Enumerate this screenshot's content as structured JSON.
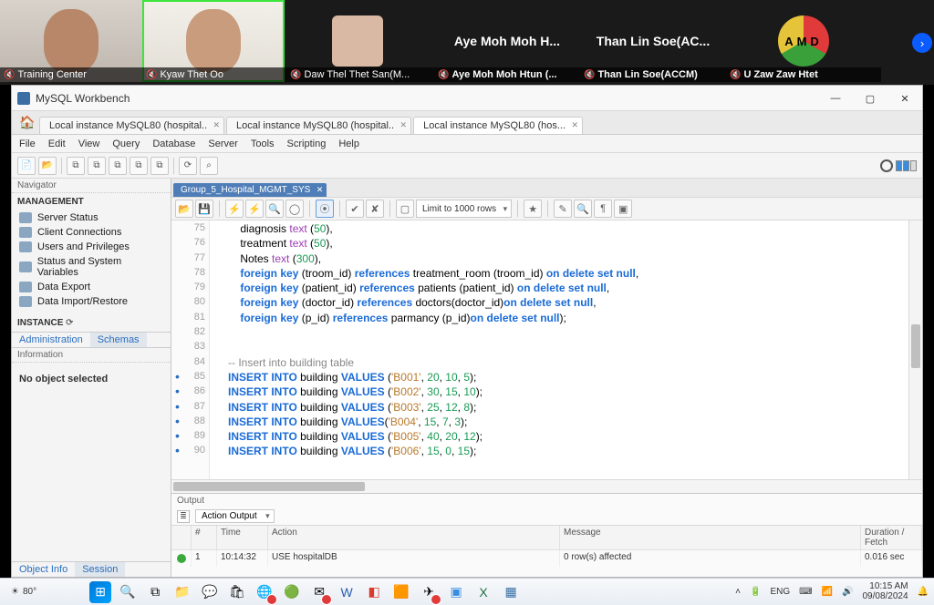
{
  "zoom": {
    "participants": [
      {
        "name": "Training Center",
        "muted": true,
        "type": "video"
      },
      {
        "name": "Kyaw Thet Oo",
        "muted": true,
        "type": "video",
        "highlighted": true
      },
      {
        "name": "Daw Thel Thet San(M...",
        "muted": true,
        "type": "video"
      },
      {
        "name": "Aye Moh Moh Htun (...",
        "muted": true,
        "display": "Aye Moh Moh H..."
      },
      {
        "name": "Than Lin Soe(ACCM)",
        "muted": true,
        "display": "Than Lin Soe(AC..."
      },
      {
        "name": "U Zaw Zaw Htet",
        "muted": true,
        "type": "logo"
      }
    ]
  },
  "workbench": {
    "title": "MySQL Workbench",
    "tabs": [
      {
        "label": "Local instance MySQL80 (hospital..",
        "active": false
      },
      {
        "label": "Local instance MySQL80 (hospital..",
        "active": false
      },
      {
        "label": "Local instance MySQL80 (hos...",
        "active": true
      }
    ],
    "menu": [
      "File",
      "Edit",
      "View",
      "Query",
      "Database",
      "Server",
      "Tools",
      "Scripting",
      "Help"
    ],
    "navigator": {
      "title": "Navigator",
      "mgmt_header": "MANAGEMENT",
      "mgmt_items": [
        "Server Status",
        "Client Connections",
        "Users and Privileges",
        "Status and System Variables",
        "Data Export",
        "Data Import/Restore"
      ],
      "instance_header": "INSTANCE",
      "instance_status": "",
      "nav_tabs": [
        "Administration",
        "Schemas"
      ],
      "info_title": "Information",
      "info_body": "No object selected",
      "bottom_tabs": [
        "Object Info",
        "Session"
      ]
    },
    "file_tab": "Group_5_Hospital_MGMT_SYS",
    "editor_toolbar": {
      "limit_label": "Limit to 1000 rows"
    },
    "code": {
      "lines": [
        {
          "n": 75,
          "html": "    diagnosis <span class='type'>text</span> (<span class='num'>50</span>),"
        },
        {
          "n": 76,
          "html": "    treatment <span class='type'>text</span> (<span class='num'>50</span>),"
        },
        {
          "n": 77,
          "html": "    Notes <span class='type'>text</span> (<span class='num'>300</span>),"
        },
        {
          "n": 78,
          "html": "    <span class='kw'>foreign key</span> (troom_id) <span class='kw'>references</span> treatment_room (troom_id) <span class='kw'>on delete set null</span>,"
        },
        {
          "n": 79,
          "html": "    <span class='kw'>foreign key</span> (patient_id) <span class='kw'>references</span> patients (patient_id) <span class='kw'>on delete set null</span>,"
        },
        {
          "n": 80,
          "html": "    <span class='kw'>foreign key</span> (doctor_id) <span class='kw'>references</span> doctors(doctor_id)<span class='kw'>on delete set null</span>,"
        },
        {
          "n": 81,
          "html": "    <span class='kw'>foreign key</span> (p_id) <span class='kw'>references</span> parmancy (p_id)<span class='kw'>on delete set null</span>);"
        },
        {
          "n": 82,
          "html": ""
        },
        {
          "n": 83,
          "html": ""
        },
        {
          "n": 84,
          "html": "<span class='cm'>-- Insert into building table</span>"
        },
        {
          "n": 85,
          "bp": true,
          "html": "<span class='kw'>INSERT INTO</span> building <span class='kw'>VALUES</span> (<span class='str'>'B001'</span>, <span class='num'>20</span>, <span class='num'>10</span>, <span class='num'>5</span>);"
        },
        {
          "n": 86,
          "bp": true,
          "html": "<span class='kw'>INSERT INTO</span> building <span class='kw'>VALUES</span> (<span class='str'>'B002'</span>, <span class='num'>30</span>, <span class='num'>15</span>, <span class='num'>10</span>);"
        },
        {
          "n": 87,
          "bp": true,
          "html": "<span class='kw'>INSERT INTO</span> building <span class='kw'>VALUES</span> (<span class='str'>'B003'</span>, <span class='num'>25</span>, <span class='num'>12</span>, <span class='num'>8</span>);"
        },
        {
          "n": 88,
          "bp": true,
          "html": "<span class='kw'>INSERT INTO</span> building <span class='kw'>VALUES</span>(<span class='str'>'B004'</span>, <span class='num'>15</span>, <span class='num'>7</span>, <span class='num'>3</span>);"
        },
        {
          "n": 89,
          "bp": true,
          "html": "<span class='kw'>INSERT INTO</span> building <span class='kw'>VALUES</span> (<span class='str'>'B005'</span>, <span class='num'>40</span>, <span class='num'>20</span>, <span class='num'>12</span>);"
        },
        {
          "n": 90,
          "bp": true,
          "html": "<span class='kw'>INSERT INTO</span> building <span class='kw'>VALUES</span> (<span class='str'>'B006'</span>, <span class='num'>15</span>, <span class='num'>0</span>, <span class='num'>15</span>);"
        }
      ]
    },
    "output": {
      "title": "Output",
      "selector": "Action Output",
      "headers": [
        "",
        "#",
        "Time",
        "Action",
        "Message",
        "Duration / Fetch"
      ],
      "row": {
        "idx": "1",
        "time": "10:14:32",
        "action": "USE hospitalDB",
        "message": "0 row(s) affected",
        "duration": "0.016 sec"
      }
    }
  },
  "taskbar": {
    "weather_temp": "80°",
    "lang": "ENG",
    "time": "10:15 AM",
    "date": "09/08/2024"
  }
}
